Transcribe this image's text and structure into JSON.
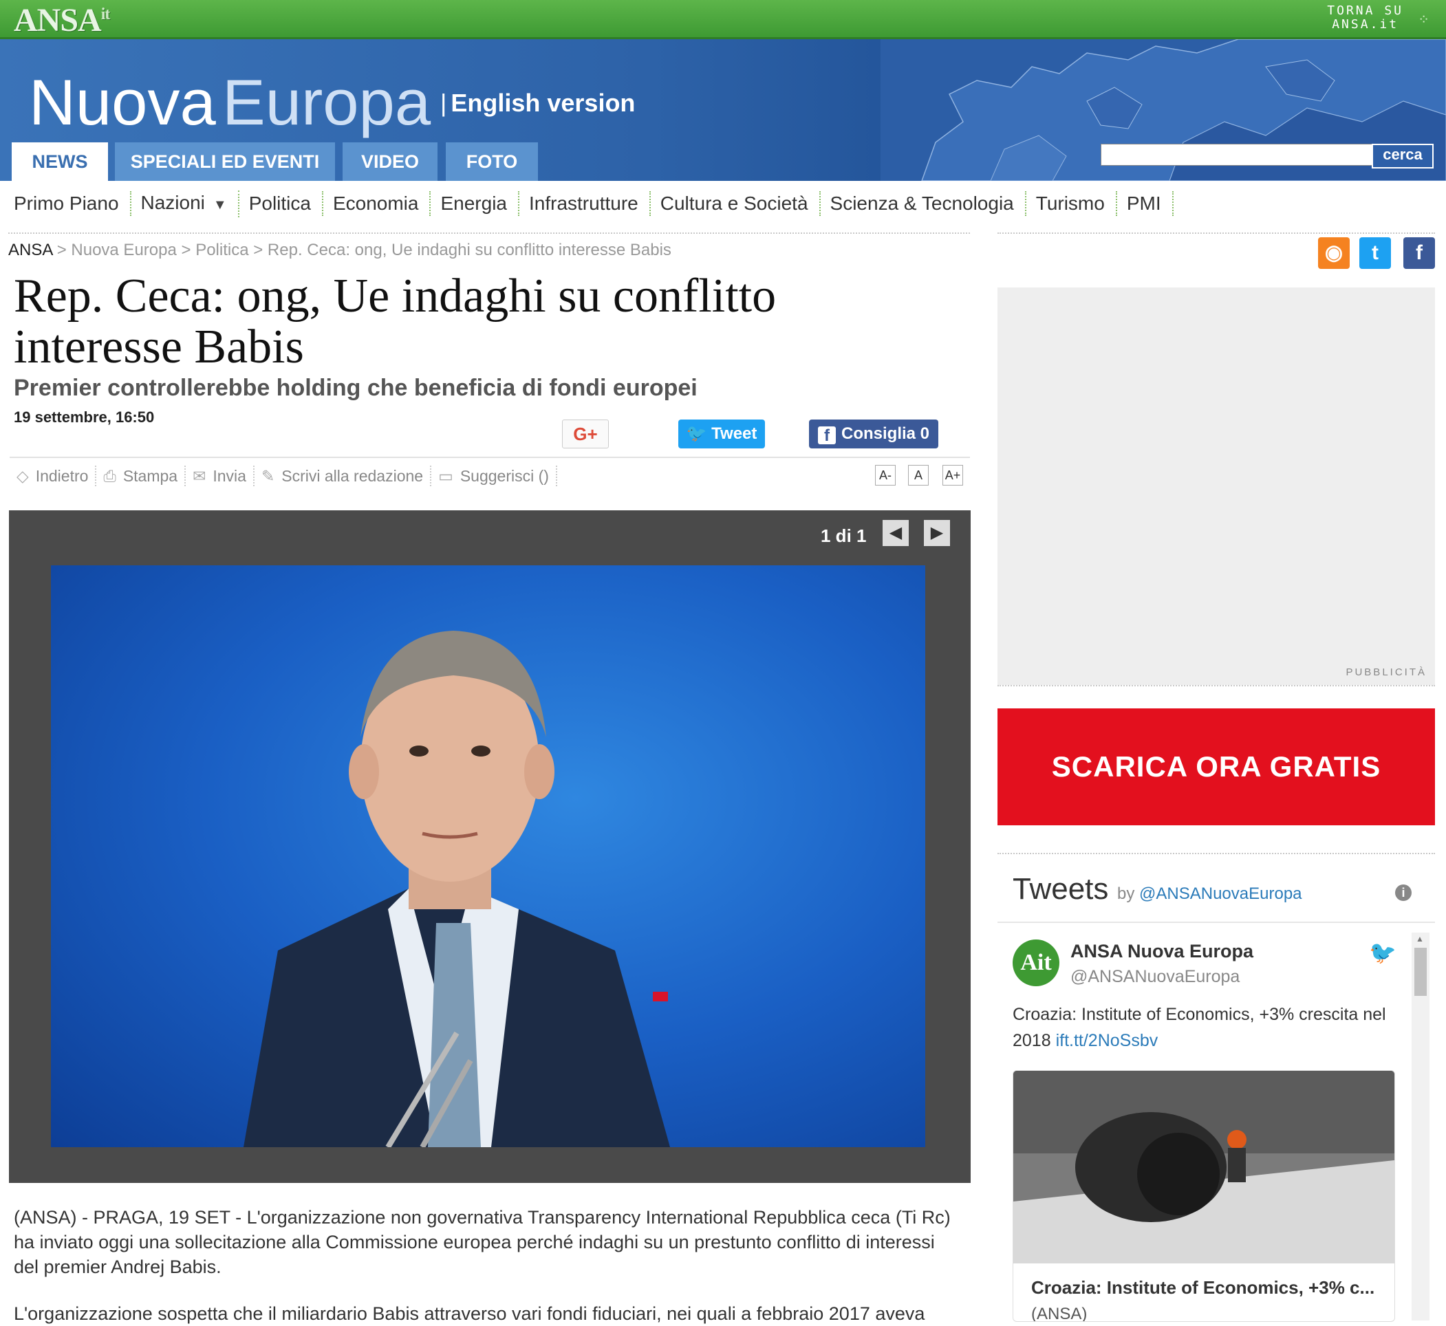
{
  "topbar": {
    "logo": "ANSA",
    "logo_suffix": "it",
    "torna_line1": "TORNA SU",
    "torna_line2": "ANSA.it"
  },
  "header": {
    "title_part1": "Nuova",
    "title_part2": "Europa",
    "english_link": "English version",
    "tabs": [
      {
        "label": "NEWS",
        "active": true
      },
      {
        "label": "SPECIALI ED EVENTI",
        "active": false
      },
      {
        "label": "VIDEO",
        "active": false
      },
      {
        "label": "FOTO",
        "active": false
      }
    ],
    "search_placeholder": "",
    "search_button": "cerca"
  },
  "sections": [
    "Primo Piano",
    "Nazioni",
    "Politica",
    "Economia",
    "Energia",
    "Infrastrutture",
    "Cultura e Società",
    "Scienza & Tecnologia",
    "Turismo",
    "PMI"
  ],
  "breadcrumb": {
    "root": "ANSA",
    "items": [
      "Nuova Europa",
      "Politica",
      "Rep. Ceca: ong, Ue indaghi su conflitto interesse Babis"
    ],
    "separator": ">"
  },
  "article": {
    "headline": "Rep. Ceca: ong, Ue indaghi su conflitto interesse Babis",
    "subtitle": "Premier controllerebbe holding che beneficia di fondi europei",
    "date": "19 settembre, 16:50",
    "share": {
      "gplus": "G+",
      "tweet": "Tweet",
      "facebook": "Consiglia 0"
    },
    "tools": [
      "Indietro",
      "Stampa",
      "Invia",
      "Scrivi alla redazione",
      "Suggerisci ()"
    ],
    "font_sizes": [
      "A-",
      "A",
      "A+"
    ],
    "gallery_counter": "1 di 1",
    "paragraphs": [
      "(ANSA) - PRAGA, 19 SET - L'organizzazione non governativa Transparency International Repubblica ceca (Ti Rc) ha inviato oggi una sollecitazione alla Commissione europea perché indaghi su un prestunto conflitto di interessi del premier Andrej Babis.",
      "L'organizzazione sospetta che il miliardario Babis attraverso vari fondi fiduciari, nei quali a febbraio 2017 aveva"
    ]
  },
  "sidebar": {
    "ad_label": "PUBBLICITÀ",
    "promo": "SCARICA ORA GRATIS",
    "tweets": {
      "heading": "Tweets",
      "by": "by",
      "handle_link": "@ANSANuovaEuropa",
      "avatar_text": "Ait",
      "author_name": "ANSA Nuova Europa",
      "author_handle": "@ANSANuovaEuropa",
      "text": "Croazia: Institute of Economics, +3% crescita nel 2018",
      "link": "ift.tt/2NoSsbv",
      "card_title": "Croazia: Institute of Economics, +3% c...",
      "card_source": "(ANSA)"
    }
  },
  "colors": {
    "green": "#3e9a33",
    "blue_header": "#2d62a8",
    "tab_blue": "#5b93cf",
    "promo_red": "#e3101e",
    "twitter": "#1da1f2",
    "facebook": "#3b5998"
  },
  "icons": {
    "rss": "rss-icon",
    "twitter": "twitter-icon",
    "facebook": "facebook-icon",
    "prev": "chevron-left-icon",
    "next": "chevron-right-icon"
  }
}
